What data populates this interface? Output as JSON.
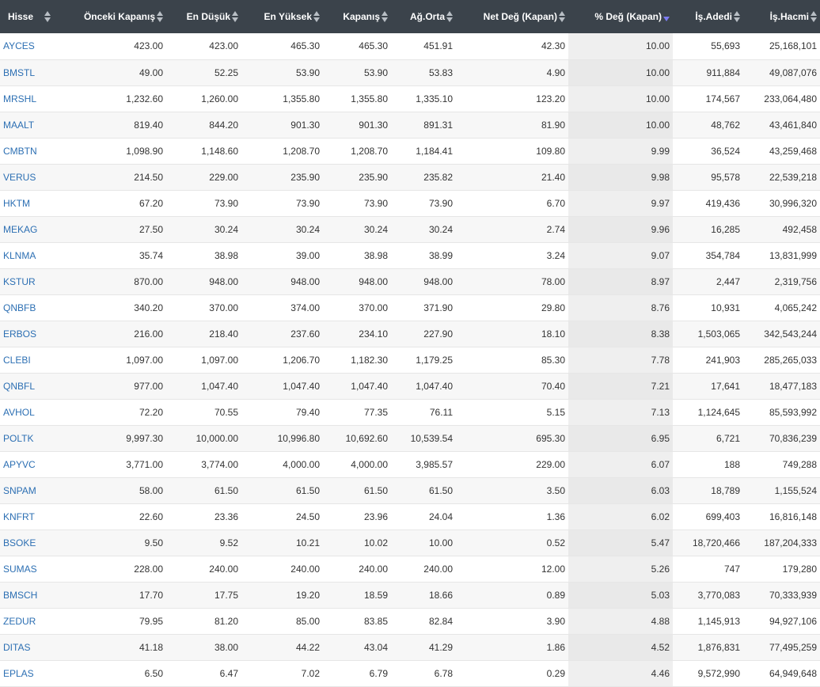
{
  "columns": [
    {
      "label": "Hisse"
    },
    {
      "label": "Önceki Kapanış"
    },
    {
      "label": "En Düşük"
    },
    {
      "label": "En Yüksek"
    },
    {
      "label": "Kapanış"
    },
    {
      "label": "Ağ.Orta"
    },
    {
      "label": "Net Değ (Kapan)"
    },
    {
      "label": "% Değ (Kapan)"
    },
    {
      "label": "İş.Adedi"
    },
    {
      "label": "İş.Hacmi"
    }
  ],
  "sorted_column_index": 7,
  "rows": [
    [
      "AYCES",
      "423.00",
      "423.00",
      "465.30",
      "465.30",
      "451.91",
      "42.30",
      "10.00",
      "55,693",
      "25,168,101"
    ],
    [
      "BMSTL",
      "49.00",
      "52.25",
      "53.90",
      "53.90",
      "53.83",
      "4.90",
      "10.00",
      "911,884",
      "49,087,076"
    ],
    [
      "MRSHL",
      "1,232.60",
      "1,260.00",
      "1,355.80",
      "1,355.80",
      "1,335.10",
      "123.20",
      "10.00",
      "174,567",
      "233,064,480"
    ],
    [
      "MAALT",
      "819.40",
      "844.20",
      "901.30",
      "901.30",
      "891.31",
      "81.90",
      "10.00",
      "48,762",
      "43,461,840"
    ],
    [
      "CMBTN",
      "1,098.90",
      "1,148.60",
      "1,208.70",
      "1,208.70",
      "1,184.41",
      "109.80",
      "9.99",
      "36,524",
      "43,259,468"
    ],
    [
      "VERUS",
      "214.50",
      "229.00",
      "235.90",
      "235.90",
      "235.82",
      "21.40",
      "9.98",
      "95,578",
      "22,539,218"
    ],
    [
      "HKTM",
      "67.20",
      "73.90",
      "73.90",
      "73.90",
      "73.90",
      "6.70",
      "9.97",
      "419,436",
      "30,996,320"
    ],
    [
      "MEKAG",
      "27.50",
      "30.24",
      "30.24",
      "30.24",
      "30.24",
      "2.74",
      "9.96",
      "16,285",
      "492,458"
    ],
    [
      "KLNMA",
      "35.74",
      "38.98",
      "39.00",
      "38.98",
      "38.99",
      "3.24",
      "9.07",
      "354,784",
      "13,831,999"
    ],
    [
      "KSTUR",
      "870.00",
      "948.00",
      "948.00",
      "948.00",
      "948.00",
      "78.00",
      "8.97",
      "2,447",
      "2,319,756"
    ],
    [
      "QNBFB",
      "340.20",
      "370.00",
      "374.00",
      "370.00",
      "371.90",
      "29.80",
      "8.76",
      "10,931",
      "4,065,242"
    ],
    [
      "ERBOS",
      "216.00",
      "218.40",
      "237.60",
      "234.10",
      "227.90",
      "18.10",
      "8.38",
      "1,503,065",
      "342,543,244"
    ],
    [
      "CLEBI",
      "1,097.00",
      "1,097.00",
      "1,206.70",
      "1,182.30",
      "1,179.25",
      "85.30",
      "7.78",
      "241,903",
      "285,265,033"
    ],
    [
      "QNBFL",
      "977.00",
      "1,047.40",
      "1,047.40",
      "1,047.40",
      "1,047.40",
      "70.40",
      "7.21",
      "17,641",
      "18,477,183"
    ],
    [
      "AVHOL",
      "72.20",
      "70.55",
      "79.40",
      "77.35",
      "76.11",
      "5.15",
      "7.13",
      "1,124,645",
      "85,593,992"
    ],
    [
      "POLTK",
      "9,997.30",
      "10,000.00",
      "10,996.80",
      "10,692.60",
      "10,539.54",
      "695.30",
      "6.95",
      "6,721",
      "70,836,239"
    ],
    [
      "APYVC",
      "3,771.00",
      "3,774.00",
      "4,000.00",
      "4,000.00",
      "3,985.57",
      "229.00",
      "6.07",
      "188",
      "749,288"
    ],
    [
      "SNPAM",
      "58.00",
      "61.50",
      "61.50",
      "61.50",
      "61.50",
      "3.50",
      "6.03",
      "18,789",
      "1,155,524"
    ],
    [
      "KNFRT",
      "22.60",
      "23.36",
      "24.50",
      "23.96",
      "24.04",
      "1.36",
      "6.02",
      "699,403",
      "16,816,148"
    ],
    [
      "BSOKE",
      "9.50",
      "9.52",
      "10.21",
      "10.02",
      "10.00",
      "0.52",
      "5.47",
      "18,720,466",
      "187,204,333"
    ],
    [
      "SUMAS",
      "228.00",
      "240.00",
      "240.00",
      "240.00",
      "240.00",
      "12.00",
      "5.26",
      "747",
      "179,280"
    ],
    [
      "BMSCH",
      "17.70",
      "17.75",
      "19.20",
      "18.59",
      "18.66",
      "0.89",
      "5.03",
      "3,770,083",
      "70,333,939"
    ],
    [
      "ZEDUR",
      "79.95",
      "81.20",
      "85.00",
      "83.85",
      "82.84",
      "3.90",
      "4.88",
      "1,145,913",
      "94,927,106"
    ],
    [
      "DITAS",
      "41.18",
      "38.00",
      "44.22",
      "43.04",
      "41.29",
      "1.86",
      "4.52",
      "1,876,831",
      "77,495,259"
    ],
    [
      "EPLAS",
      "6.50",
      "6.47",
      "7.02",
      "6.79",
      "6.78",
      "0.29",
      "4.46",
      "9,572,990",
      "64,949,648"
    ]
  ]
}
